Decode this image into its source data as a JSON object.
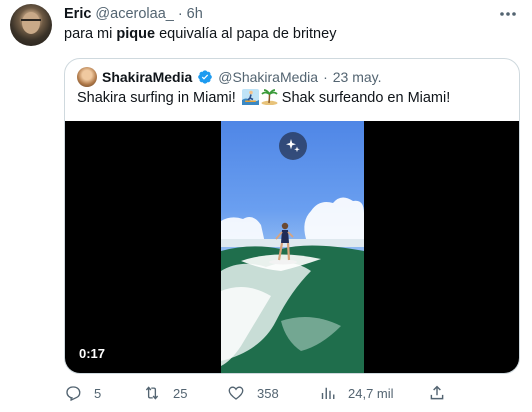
{
  "tweet": {
    "author_name": "Eric",
    "author_handle": "@acerolaa_",
    "separator": "·",
    "time": "6h",
    "text_before": "para mi ",
    "text_bold": "pique",
    "text_after": " equivalía al papa de britney"
  },
  "quote": {
    "author_name": "ShakiraMedia",
    "author_handle": "@ShakiraMedia",
    "separator": "·",
    "time": "23 may.",
    "text_before": "Shakira surfing in Miami! ",
    "text_after": " Shak surfeando en Miami!",
    "emojis": [
      "surfer-emoji",
      "palm-island-emoji"
    ],
    "verified_color": "#1d9bf0",
    "video_duration": "0:17"
  },
  "actions": {
    "replies": "5",
    "retweets": "25",
    "likes": "358",
    "views": "24,7 mil"
  }
}
